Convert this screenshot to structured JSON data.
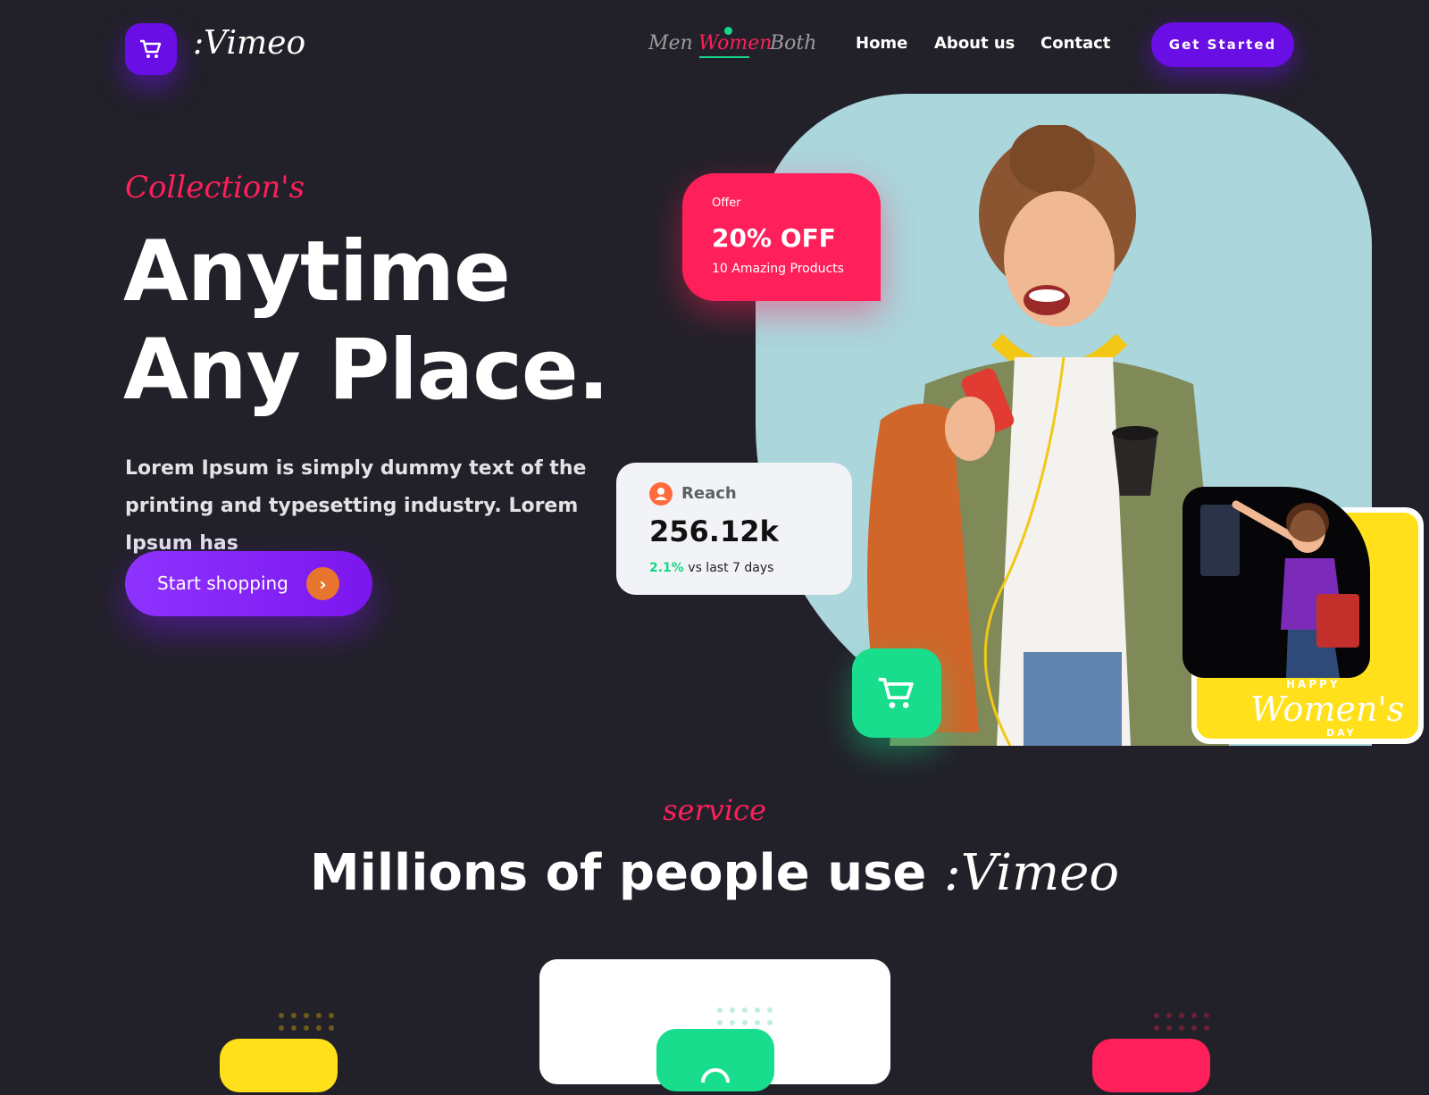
{
  "brand": {
    "name": ":Vimeo"
  },
  "gender_filter": {
    "items": [
      "Men",
      "Women",
      "Both"
    ],
    "active": "Women"
  },
  "nav": {
    "home": "Home",
    "about": "About us",
    "contact": "Contact",
    "cta": "Get Started"
  },
  "hero": {
    "eyebrow": "Collection's",
    "title_line1": "Anytime",
    "title_line2": "Any Place.",
    "description": "Lorem Ipsum is simply dummy text of the printing and typesetting industry. Lorem Ipsum has",
    "button_label": "Start shopping",
    "button_icon": "chevron-right-icon"
  },
  "offer_card": {
    "label": "Offer",
    "headline": "20% OFF",
    "sub": "10 Amazing Products"
  },
  "reach_card": {
    "label": "Reach",
    "value": "256.12k",
    "change": "2.1%",
    "change_suffix": " vs last 7 days",
    "icon": "user-icon"
  },
  "promo_card": {
    "happy": "HAPPY",
    "womens": "Women's",
    "day": "DAY"
  },
  "services": {
    "eyebrow": "service",
    "title": "Millions of people use ",
    "brand": ":Vimeo"
  },
  "colors": {
    "background": "#222129",
    "accent_purple": "#6a0ee6",
    "accent_pink": "#ff1f5a",
    "accent_green": "#17dd8d",
    "accent_yellow": "#ffe01a"
  }
}
